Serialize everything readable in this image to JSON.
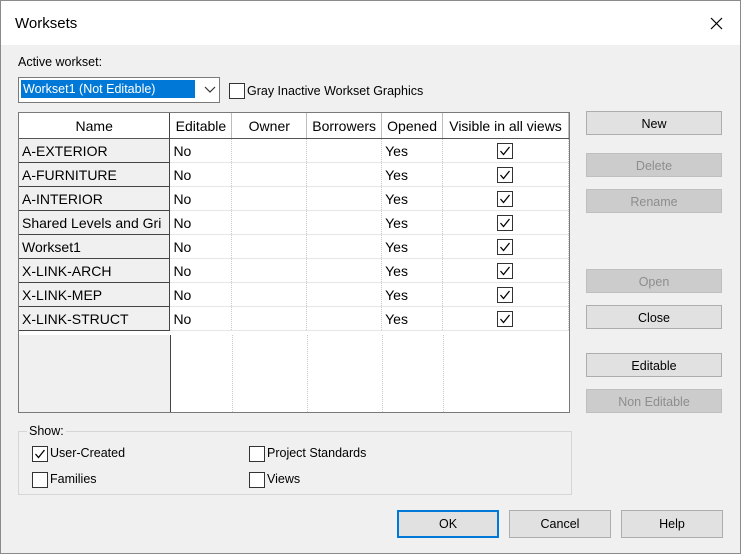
{
  "window": {
    "title": "Worksets"
  },
  "active_workset": {
    "label": "Active workset:",
    "value": "Workset1 (Not Editable)"
  },
  "gray_inactive": {
    "label": "Gray Inactive Workset Graphics",
    "checked": false
  },
  "table": {
    "columns": [
      "Name",
      "Editable",
      "Owner",
      "Borrowers",
      "Opened",
      "Visible in all views"
    ],
    "rows": [
      {
        "name": "A-EXTERIOR",
        "editable": "No",
        "owner": "",
        "borrowers": "",
        "opened": "Yes",
        "visible": true
      },
      {
        "name": "A-FURNITURE",
        "editable": "No",
        "owner": "",
        "borrowers": "",
        "opened": "Yes",
        "visible": true
      },
      {
        "name": "A-INTERIOR",
        "editable": "No",
        "owner": "",
        "borrowers": "",
        "opened": "Yes",
        "visible": true
      },
      {
        "name": "Shared Levels and Gri",
        "editable": "No",
        "owner": "",
        "borrowers": "",
        "opened": "Yes",
        "visible": true
      },
      {
        "name": "Workset1",
        "editable": "No",
        "owner": "",
        "borrowers": "",
        "opened": "Yes",
        "visible": true
      },
      {
        "name": "X-LINK-ARCH",
        "editable": "No",
        "owner": "",
        "borrowers": "",
        "opened": "Yes",
        "visible": true
      },
      {
        "name": "X-LINK-MEP",
        "editable": "No",
        "owner": "",
        "borrowers": "",
        "opened": "Yes",
        "visible": true
      },
      {
        "name": "X-LINK-STRUCT",
        "editable": "No",
        "owner": "",
        "borrowers": "",
        "opened": "Yes",
        "visible": true
      }
    ]
  },
  "side_buttons": {
    "new": "New",
    "delete": "Delete",
    "rename": "Rename",
    "open": "Open",
    "close": "Close",
    "editable": "Editable",
    "non_editable": "Non Editable"
  },
  "show": {
    "label": "Show:",
    "user_created": {
      "label": "User-Created",
      "checked": true
    },
    "families": {
      "label": "Families",
      "checked": false
    },
    "project_standards": {
      "label": "Project Standards",
      "checked": false
    },
    "views": {
      "label": "Views",
      "checked": false
    }
  },
  "footer": {
    "ok": "OK",
    "cancel": "Cancel",
    "help": "Help"
  },
  "colors": {
    "selection": "#0078d7",
    "dialog_bg": "#f0f0f0",
    "disabled_text": "#8d8d8d"
  },
  "icons": {
    "close": "close-icon",
    "dropdown": "chevron-down-icon",
    "check": "checkmark-icon"
  }
}
